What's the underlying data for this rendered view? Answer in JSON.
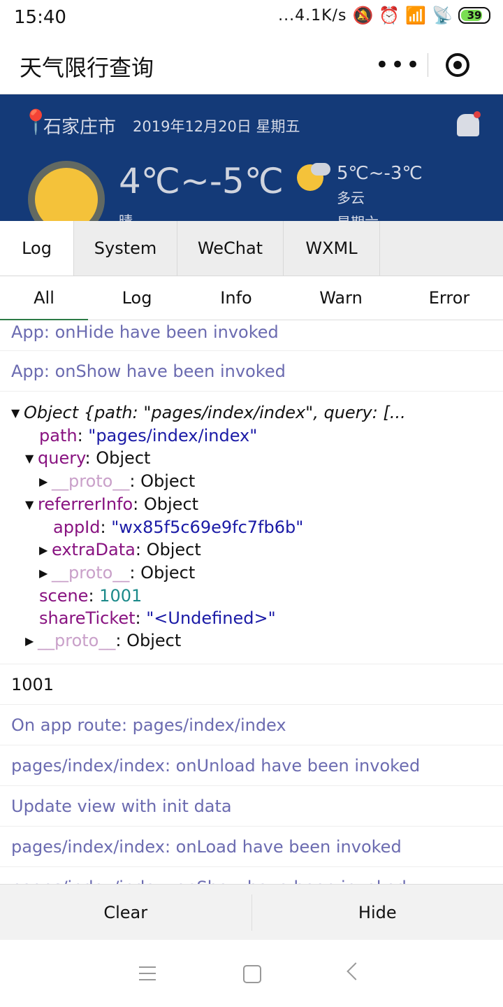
{
  "status_bar": {
    "time": "15:40",
    "network_speed": "...4.1K/s",
    "battery": "39",
    "icons": [
      "mute-icon",
      "alarm-icon",
      "signal-icon",
      "wifi-icon",
      "battery-icon"
    ]
  },
  "app": {
    "title": "天气限行查询",
    "more_icon": "•••",
    "close_icon": "target-icon"
  },
  "weather": {
    "city": "石家庄市",
    "date": "2019年12月20日 星期五",
    "temp": "4℃~-5℃",
    "condition": "晴",
    "next_temp": "5℃~-3℃",
    "next_condition": "多云",
    "next_day": "星期六"
  },
  "console": {
    "tabs": [
      "Log",
      "System",
      "WeChat",
      "WXML"
    ],
    "active_tab": "Log",
    "filters": [
      "All",
      "Log",
      "Info",
      "Warn",
      "Error"
    ],
    "active_filter": "All",
    "logs": {
      "line1": "App: onHide have been invoked",
      "line2": "App: onShow have been invoked",
      "object": {
        "summary": "Object {path: \"pages/index/index\", query: [...",
        "path_key": "path",
        "path_val": "\"pages/index/index\"",
        "query_key": "query",
        "object_label": "Object",
        "proto_key": "__proto__",
        "referrer_key": "referrerInfo",
        "appid_key": "appId",
        "appid_val": "\"wx85f5c69e9fc7fb6b\"",
        "extra_key": "extraData",
        "scene_key": "scene",
        "scene_val": "1001",
        "share_key": "shareTicket",
        "share_val": "\"<Undefined>\""
      },
      "line4": "1001",
      "line5": "On app route: pages/index/index",
      "line6": "pages/index/index: onUnload have been invoked",
      "line7": "Update view with init data",
      "line8": "pages/index/index: onLoad have been invoked",
      "line9": "pages/index/index: onShow have been invoked"
    },
    "buttons": {
      "clear": "Clear",
      "hide": "Hide"
    }
  }
}
